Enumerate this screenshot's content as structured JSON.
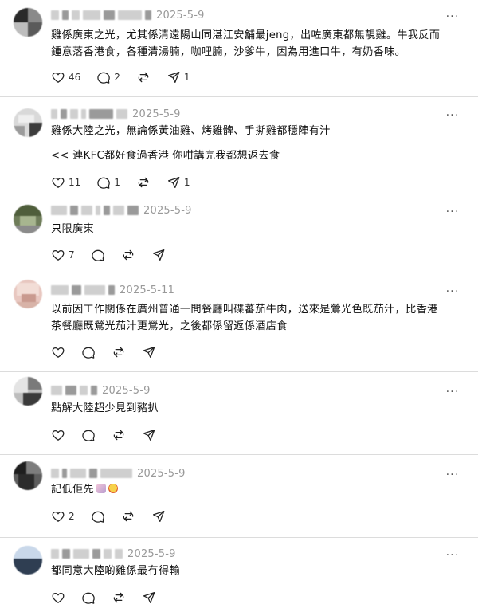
{
  "comments": [
    {
      "date": "2025-5-9",
      "text_lines": [
        "雞係廣東之光，尤其係清遠陽山同湛江安舖最jeng，出咗廣東都無靚雞。牛我反而",
        "鍾意落香港食，各種清湯腩，咖哩腩，沙爹牛，因為用進口牛，有奶香味。"
      ],
      "likes": "46",
      "replies": "2",
      "reposts": "",
      "shares": "1"
    },
    {
      "date": "2025-5-9",
      "text_lines": [
        "雞係大陸之光，無論係黃油雞、烤雞髀、手撕雞都穩陣有汁",
        "",
        "<< 連KFC都好食過香港 你咁講完我都想返去食"
      ],
      "likes": "11",
      "replies": "1",
      "reposts": "",
      "shares": "1"
    },
    {
      "date": "2025-5-9",
      "text_lines": [
        "只限廣東"
      ],
      "likes": "7",
      "replies": "",
      "reposts": "",
      "shares": ""
    },
    {
      "date": "2025-5-11",
      "text_lines": [
        "以前因工作關係在廣州普通一間餐廳叫碟蕃茄牛肉，送來是鶯光色既茄汁，比香港",
        "茶餐廳既鶯光茄汁更鶯光，之後都係留返係酒店食"
      ],
      "likes": "",
      "replies": "",
      "reposts": "",
      "shares": ""
    },
    {
      "date": "2025-5-9",
      "text_lines": [
        "點解大陸超少見到豬扒"
      ],
      "likes": "",
      "replies": "",
      "reposts": "",
      "shares": ""
    },
    {
      "date": "2025-5-9",
      "text_lines": [
        "記低佢先"
      ],
      "likes": "2",
      "replies": "",
      "reposts": "",
      "shares": ""
    },
    {
      "date": "2025-5-9",
      "text_lines": [
        "都同意大陸啲雞係最冇得輸"
      ],
      "likes": "",
      "replies": "",
      "reposts": "",
      "shares": ""
    }
  ],
  "icons": {
    "like": "heart-icon",
    "reply": "comment-icon",
    "repost": "repost-icon",
    "share": "share-icon",
    "more": "more-icon"
  },
  "colors": {
    "divider": "#dcdcdc",
    "meta": "#999999",
    "text": "#111111"
  }
}
